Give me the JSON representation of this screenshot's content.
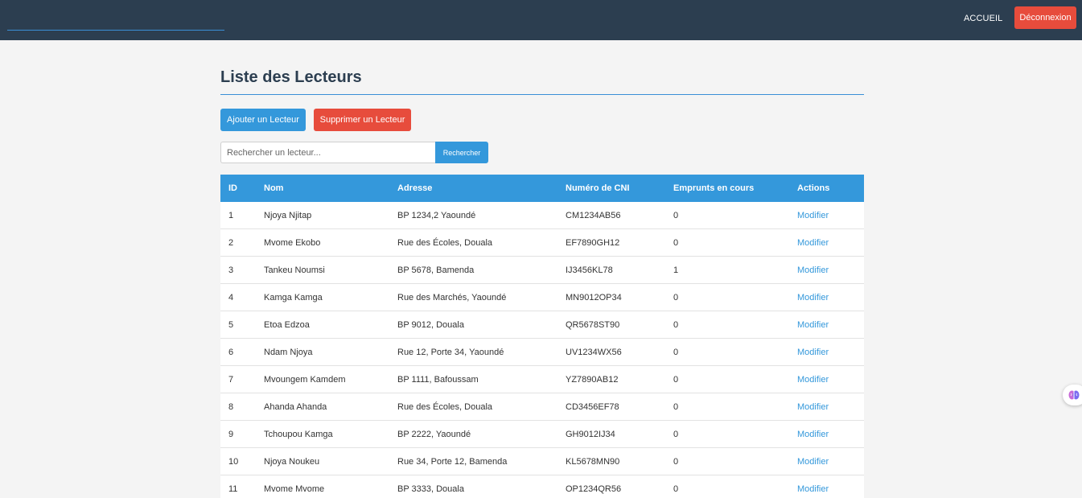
{
  "nav": {
    "home_label": "ACCUEIL",
    "logout_label": "Déconnexion"
  },
  "page": {
    "title": "Liste des Lecteurs"
  },
  "actions": {
    "add_label": "Ajouter un Lecteur",
    "delete_label": "Supprimer un Lecteur"
  },
  "search": {
    "placeholder": "Rechercher un lecteur...",
    "button_label": "Rechercher"
  },
  "table": {
    "headers": {
      "id": "ID",
      "nom": "Nom",
      "adresse": "Adresse",
      "cni": "Numéro de CNI",
      "emprunts": "Emprunts en cours",
      "actions": "Actions"
    },
    "rows": [
      {
        "id": "1",
        "nom": "Njoya Njitap",
        "adresse": "BP 1234,2 Yaoundé",
        "cni": "CM1234AB56",
        "emprunts": "0",
        "action": "Modifier"
      },
      {
        "id": "2",
        "nom": "Mvome Ekobo",
        "adresse": "Rue des Écoles, Douala",
        "cni": "EF7890GH12",
        "emprunts": "0",
        "action": "Modifier"
      },
      {
        "id": "3",
        "nom": "Tankeu Noumsi",
        "adresse": "BP 5678, Bamenda",
        "cni": "IJ3456KL78",
        "emprunts": "1",
        "action": "Modifier"
      },
      {
        "id": "4",
        "nom": "Kamga Kamga",
        "adresse": "Rue des Marchés, Yaoundé",
        "cni": "MN9012OP34",
        "emprunts": "0",
        "action": "Modifier"
      },
      {
        "id": "5",
        "nom": "Etoa Edzoa",
        "adresse": "BP 9012, Douala",
        "cni": "QR5678ST90",
        "emprunts": "0",
        "action": "Modifier"
      },
      {
        "id": "6",
        "nom": "Ndam Njoya",
        "adresse": "Rue 12, Porte 34, Yaoundé",
        "cni": "UV1234WX56",
        "emprunts": "0",
        "action": "Modifier"
      },
      {
        "id": "7",
        "nom": "Mvoungem Kamdem",
        "adresse": "BP 1111, Bafoussam",
        "cni": "YZ7890AB12",
        "emprunts": "0",
        "action": "Modifier"
      },
      {
        "id": "8",
        "nom": "Ahanda Ahanda",
        "adresse": "Rue des Écoles, Douala",
        "cni": "CD3456EF78",
        "emprunts": "0",
        "action": "Modifier"
      },
      {
        "id": "9",
        "nom": "Tchoupou Kamga",
        "adresse": "BP 2222, Yaoundé",
        "cni": "GH9012IJ34",
        "emprunts": "0",
        "action": "Modifier"
      },
      {
        "id": "10",
        "nom": "Njoya Noukeu",
        "adresse": "Rue 34, Porte 12, Bamenda",
        "cni": "KL5678MN90",
        "emprunts": "0",
        "action": "Modifier"
      },
      {
        "id": "11",
        "nom": "Mvome Mvome",
        "adresse": "BP 3333, Douala",
        "cni": "OP1234QR56",
        "emprunts": "0",
        "action": "Modifier"
      }
    ]
  },
  "colors": {
    "navbar": "#2c3e50",
    "primary": "#3498db",
    "danger": "#e74c3c"
  },
  "icons": {
    "floating": "brain-icon"
  }
}
